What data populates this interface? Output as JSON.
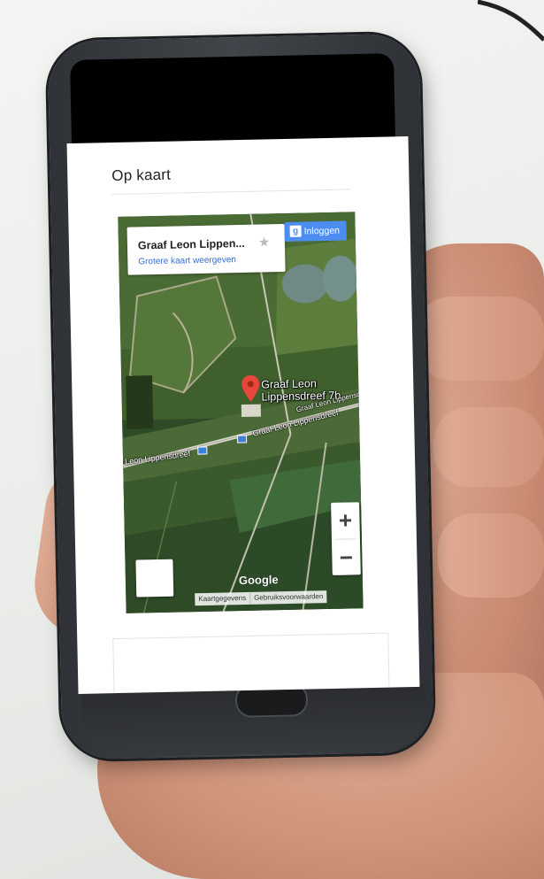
{
  "page": {
    "section_title": "Op kaart"
  },
  "map": {
    "place_name": "Graaf Leon Lippen...",
    "larger_map_link": "Grotere kaart weergeven",
    "login_button": "Inloggen",
    "login_icon_letter": "g",
    "marker_label_line1": "Graaf Leon",
    "marker_label_line2": "Lippensdreef 7b",
    "road_label_left": "Leon Lippensdreef",
    "road_label_right": "Graaf Leon Lippensdreef",
    "road_label_far": "Graaf Leon Lippensdreef",
    "zoom_in": "+",
    "zoom_out": "−",
    "google_logo": "Google",
    "footer": [
      "Kaartgegevens",
      "Gebruiksvoorwaarden"
    ],
    "icons": {
      "star": "star-icon",
      "marker": "map-marker-icon",
      "login": "google-login-icon"
    },
    "colors": {
      "login_button": "#4d8df0",
      "marker": "#e8453c",
      "link": "#3a6fd0"
    }
  }
}
